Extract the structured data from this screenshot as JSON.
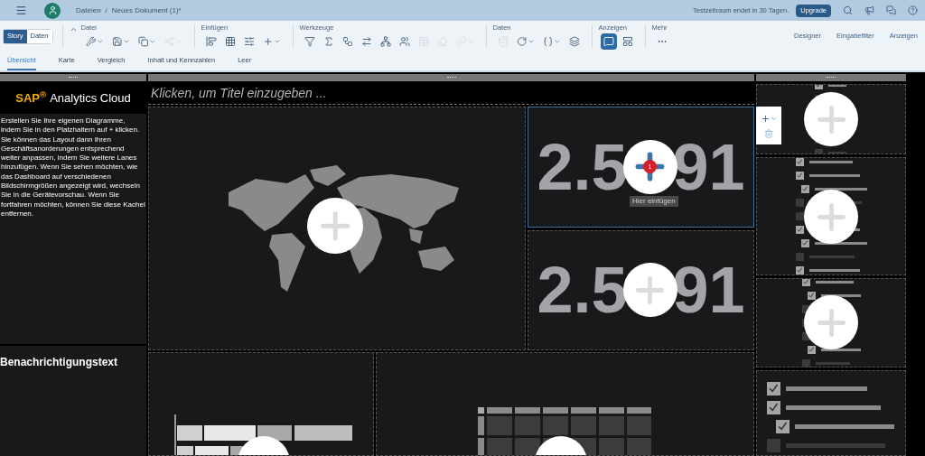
{
  "shell": {
    "breadcrumb": [
      "Dateien",
      "Neues Dokument (1)*"
    ],
    "breadcrumb_separator": "/",
    "trial_notice": "Testzeitraum endet in 30 Tagen.",
    "upgrade_button": "Upgrade"
  },
  "toolbar": {
    "modes": [
      {
        "label": "Story",
        "selected": true
      },
      {
        "label": "Daten",
        "selected": false
      }
    ],
    "groups": [
      {
        "label": "Datei",
        "tools": [
          {
            "kind": "tools",
            "menu": true,
            "disabled": false,
            "selected": false
          },
          {
            "kind": "save",
            "menu": true,
            "disabled": false,
            "selected": false
          },
          {
            "kind": "copy",
            "menu": true,
            "disabled": false,
            "selected": false
          },
          {
            "kind": "share",
            "menu": true,
            "disabled": true,
            "selected": false
          }
        ]
      },
      {
        "label": "Einfügen",
        "tools": [
          {
            "kind": "chart",
            "menu": false,
            "disabled": false,
            "selected": false
          },
          {
            "kind": "table",
            "menu": false,
            "disabled": false,
            "selected": false
          },
          {
            "kind": "controls",
            "menu": false,
            "disabled": false,
            "selected": false
          },
          {
            "kind": "add",
            "menu": true,
            "disabled": false,
            "selected": false
          }
        ]
      },
      {
        "label": "Werkzeuge",
        "tools": [
          {
            "kind": "filter",
            "menu": false,
            "disabled": false,
            "selected": false
          },
          {
            "kind": "formula",
            "menu": false,
            "disabled": false,
            "selected": false
          },
          {
            "kind": "hierarchy",
            "menu": false,
            "disabled": false,
            "selected": false
          },
          {
            "kind": "swap",
            "menu": false,
            "disabled": false,
            "selected": false
          },
          {
            "kind": "network",
            "menu": false,
            "disabled": false,
            "selected": false
          },
          {
            "kind": "people",
            "menu": false,
            "disabled": false,
            "selected": false
          },
          {
            "kind": "grid",
            "menu": false,
            "disabled": true,
            "selected": false
          },
          {
            "kind": "eraser",
            "menu": false,
            "disabled": true,
            "selected": false
          },
          {
            "kind": "link",
            "menu": true,
            "disabled": true,
            "selected": false
          }
        ]
      },
      {
        "label": "Daten",
        "tools": [
          {
            "kind": "database",
            "menu": false,
            "disabled": true,
            "selected": false
          },
          {
            "kind": "refresh",
            "menu": true,
            "disabled": false,
            "selected": false
          },
          {
            "kind": "braces",
            "menu": true,
            "disabled": false,
            "selected": false
          },
          {
            "kind": "layers",
            "menu": false,
            "disabled": false,
            "selected": false
          }
        ]
      },
      {
        "label": "Anzeigen",
        "tools": [
          {
            "kind": "comment",
            "menu": false,
            "disabled": false,
            "selected": true
          },
          {
            "kind": "layout",
            "menu": false,
            "disabled": false,
            "selected": false
          }
        ]
      },
      {
        "label": "Mehr",
        "tools": [
          {
            "kind": "more",
            "menu": false,
            "disabled": false,
            "selected": false
          }
        ]
      }
    ],
    "panels": [
      "Designer",
      "Eingabefilter",
      "Anzeigen"
    ]
  },
  "page_tabs": [
    {
      "label": "Übersicht",
      "selected": true
    },
    {
      "label": "Karte",
      "selected": false
    },
    {
      "label": "Vergleich",
      "selected": false
    },
    {
      "label": "Inhalt und Kennzahlen",
      "selected": false
    },
    {
      "label": "Leer",
      "selected": false
    }
  ],
  "canvas": {
    "brand": {
      "mark": "SAP$^{®}$",
      "name": "Analytics Cloud"
    },
    "intro_text": "Erstellen Sie Ihre eigenen Diagramme, indem Sie in den Platzhaltern auf + klicken. Sie können das Layout dann Ihren Geschäftsanorderungen entsprechend weiter anpassen, indem Sie weitere Lanes hinzufügen. Wenn Sie sehen möchten, wie das Dashboard auf verschiedenen Bildschirmgrößen angezeigt wird, wechseln Sie in die Gerätevorschau. Wenn Sie fortfahren möchten, können Sie diese Kachel entfernen.",
    "notification_title": "Benachrichtigungstext",
    "title_placeholder": "Klicken, um Titel einzugeben ...",
    "kpis": [
      {
        "parts": [
          "2.5",
          "91"
        ],
        "selected": true,
        "badge": "1",
        "tooltip": "Hier einfügen"
      },
      {
        "parts": [
          "2.5",
          "91"
        ],
        "selected": false
      }
    ]
  }
}
